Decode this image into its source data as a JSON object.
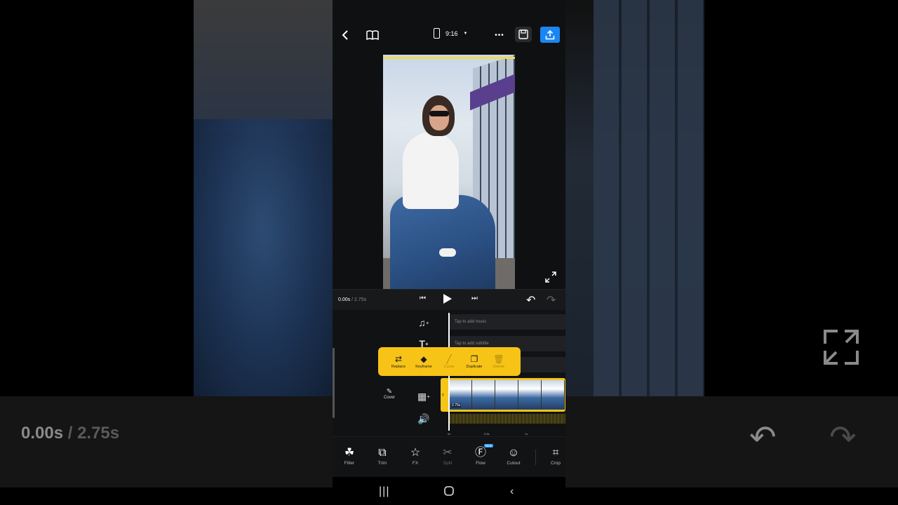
{
  "background": {
    "time_current": "0.00s",
    "time_total": "/ 2.75s"
  },
  "topbar": {
    "aspect_ratio": "9:16",
    "more_label": "•••"
  },
  "playback": {
    "current": "0.00s",
    "total": " / 2.75s"
  },
  "timeline": {
    "music_placeholder": "Tap to add music",
    "subtitle_placeholder": "Tap to add subtitle",
    "cover_label": "Cover",
    "clip_duration": "2.75s",
    "ruler": [
      "0s",
      "0.5s",
      "1s"
    ]
  },
  "popup": {
    "items": [
      {
        "label": "Replace",
        "icon": "replace-icon",
        "enabled": true
      },
      {
        "label": "Keyframe",
        "icon": "keyframe-icon",
        "enabled": true
      },
      {
        "label": "Curve",
        "icon": "curve-icon",
        "enabled": false
      },
      {
        "label": "Duplicate",
        "icon": "duplicate-icon",
        "enabled": true
      },
      {
        "label": "Delete",
        "icon": "delete-icon",
        "enabled": false
      }
    ]
  },
  "toolbar": {
    "items": [
      {
        "label": "Filter",
        "icon": "filter-icon",
        "enabled": true
      },
      {
        "label": "Trim",
        "icon": "trim-icon",
        "enabled": true
      },
      {
        "label": "FX",
        "icon": "fx-icon",
        "enabled": true
      },
      {
        "label": "Split",
        "icon": "scissors-icon",
        "enabled": false
      },
      {
        "label": "Flow",
        "icon": "flow-icon",
        "enabled": true,
        "badge": "New"
      },
      {
        "label": "Cutout",
        "icon": "cutout-icon",
        "enabled": true
      },
      {
        "label": "Crop",
        "icon": "crop-icon",
        "enabled": true
      }
    ]
  },
  "colors": {
    "accent_yellow": "#f7c316",
    "export_blue": "#1a86f3",
    "new_badge": "#2da0ff"
  }
}
